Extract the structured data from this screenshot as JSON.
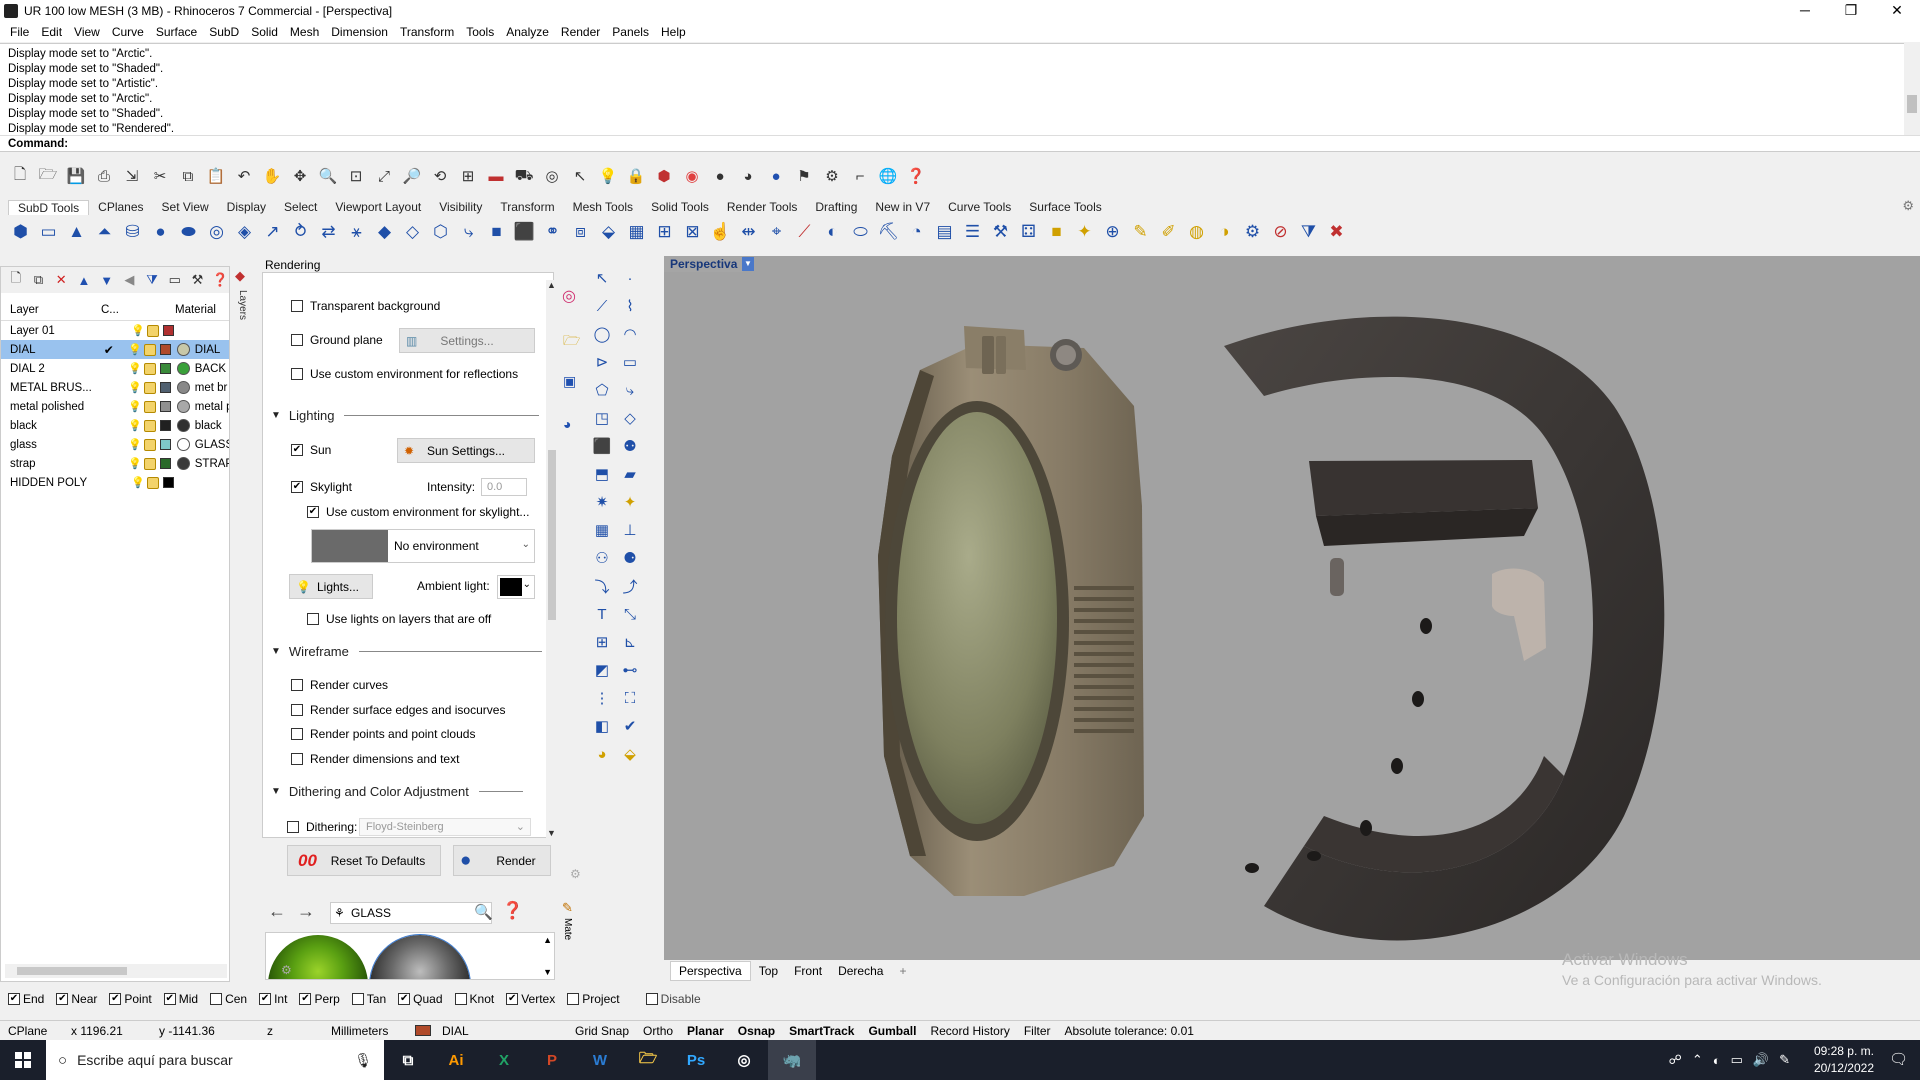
{
  "window": {
    "title": "UR 100 low MESH (3 MB) - Rhinoceros 7 Commercial - [Perspectiva]",
    "minimize": "─",
    "maximize": "❐",
    "close": "✕"
  },
  "menu": [
    "File",
    "Edit",
    "View",
    "Curve",
    "Surface",
    "SubD",
    "Solid",
    "Mesh",
    "Dimension",
    "Transform",
    "Tools",
    "Analyze",
    "Render",
    "Panels",
    "Help"
  ],
  "history": [
    "Display mode set to \"Arctic\".",
    "Display mode set to \"Shaded\".",
    "Display mode set to \"Artistic\".",
    "Display mode set to \"Arctic\".",
    "Display mode set to \"Shaded\".",
    "Display mode set to \"Rendered\"."
  ],
  "command": {
    "label": "Command:"
  },
  "toolbar_tabs": [
    "SubD Tools",
    "CPlanes",
    "Set View",
    "Display",
    "Select",
    "Viewport Layout",
    "Visibility",
    "Transform",
    "Mesh Tools",
    "Solid Tools",
    "Render Tools",
    "Drafting",
    "New in V7",
    "Curve Tools",
    "Surface Tools"
  ],
  "layers": {
    "headers": {
      "layer": "Layer",
      "current": "C...",
      "material": "Material"
    },
    "rows": [
      {
        "name": "Layer 01",
        "check": "",
        "bulb": "blue",
        "color": "#b03030",
        "mat": "",
        "matcolor": ""
      },
      {
        "name": "DIAL",
        "check": "✔",
        "bulb": "",
        "color": "#b04a2a",
        "mat": "DIAL",
        "matcolor": "#c8c8a8",
        "selected": true
      },
      {
        "name": "DIAL 2",
        "check": "",
        "bulb": "yellow",
        "color": "#3a8a3a",
        "mat": "BACK I",
        "matcolor": "#3aa03a"
      },
      {
        "name": "METAL BRUS...",
        "check": "",
        "bulb": "yellow",
        "color": "#506070",
        "mat": "met br",
        "matcolor": "#888888"
      },
      {
        "name": "metal polished",
        "check": "",
        "bulb": "yellow",
        "color": "#909090",
        "mat": "metal p",
        "matcolor": "#a8a8a8"
      },
      {
        "name": "black",
        "check": "",
        "bulb": "yellow",
        "color": "#202020",
        "mat": "black",
        "matcolor": "#303030"
      },
      {
        "name": "glass",
        "check": "",
        "bulb": "yellow",
        "color": "#7ec8c8",
        "mat": "GLASS",
        "matcolor": "#ffffff"
      },
      {
        "name": "strap",
        "check": "",
        "bulb": "yellow",
        "color": "#2a6a2a",
        "mat": "STRAP",
        "matcolor": "#3a3a3a"
      },
      {
        "name": "HIDDEN POLY",
        "check": "",
        "bulb": "blue",
        "color": "#000000",
        "mat": "",
        "matcolor": ""
      }
    ],
    "side_tab": "Layers"
  },
  "rendering": {
    "title": "Rendering",
    "transparent_bg": "Transparent background",
    "ground_plane": "Ground plane",
    "ground_settings": "Settings...",
    "custom_env_reflections": "Use custom environment for reflections",
    "lighting": "Lighting",
    "sun": "Sun",
    "sun_settings": "Sun Settings...",
    "skylight": "Skylight",
    "intensity_label": "Intensity:",
    "intensity_value": "0.0",
    "custom_env_skylight": "Use custom environment for skylight...",
    "environment": "No environment",
    "lights": "Lights...",
    "ambient": "Ambient light:",
    "lights_off_layers": "Use lights on layers that are off",
    "wireframe": "Wireframe",
    "render_curves": "Render curves",
    "render_edges": "Render surface edges and isocurves",
    "render_points": "Render points and point clouds",
    "render_dims": "Render dimensions and text",
    "dithering_section": "Dithering and Color Adjustment",
    "dithering_label": "Dithering:",
    "dithering_value": "Floyd-Steinberg",
    "reset": "Reset To Defaults",
    "render": "Render",
    "reset_icon_glyph": "00"
  },
  "materials": {
    "search": "GLASS",
    "side_tab": "Mate"
  },
  "viewport": {
    "name": "Perspectiva",
    "tabs": [
      "Perspectiva",
      "Top",
      "Front",
      "Derecha"
    ],
    "add": "+"
  },
  "watermark": {
    "line1": "Activar Windows",
    "line2": "Ve a Configuración para activar Windows."
  },
  "osnap": [
    {
      "label": "End",
      "on": true
    },
    {
      "label": "Near",
      "on": true
    },
    {
      "label": "Point",
      "on": true
    },
    {
      "label": "Mid",
      "on": true
    },
    {
      "label": "Cen",
      "on": false
    },
    {
      "label": "Int",
      "on": true
    },
    {
      "label": "Perp",
      "on": true
    },
    {
      "label": "Tan",
      "on": false
    },
    {
      "label": "Quad",
      "on": true
    },
    {
      "label": "Knot",
      "on": false
    },
    {
      "label": "Vertex",
      "on": true
    },
    {
      "label": "Project",
      "on": false
    },
    {
      "label": "Disable",
      "on": false
    }
  ],
  "status": {
    "cplane": "CPlane",
    "x": "x 1196.21",
    "y": "y -1141.36",
    "z": "z",
    "units": "Millimeters",
    "layer": "DIAL",
    "gridsnap": "Grid Snap",
    "ortho": "Ortho",
    "planar": "Planar",
    "osnap": "Osnap",
    "smarttrack": "SmartTrack",
    "gumball": "Gumball",
    "history": "Record History",
    "filter": "Filter",
    "tolerance": "Absolute tolerance: 0.01"
  },
  "taskbar": {
    "search": "Escribe aquí para buscar",
    "time": "09:28 p. m.",
    "date": "20/12/2022"
  },
  "colors": {
    "accent": "#1f4fa8",
    "viewport_bg": "#a2a2a2",
    "selected_row": "#99c2ee",
    "taskbar": "#1a1f2b"
  }
}
